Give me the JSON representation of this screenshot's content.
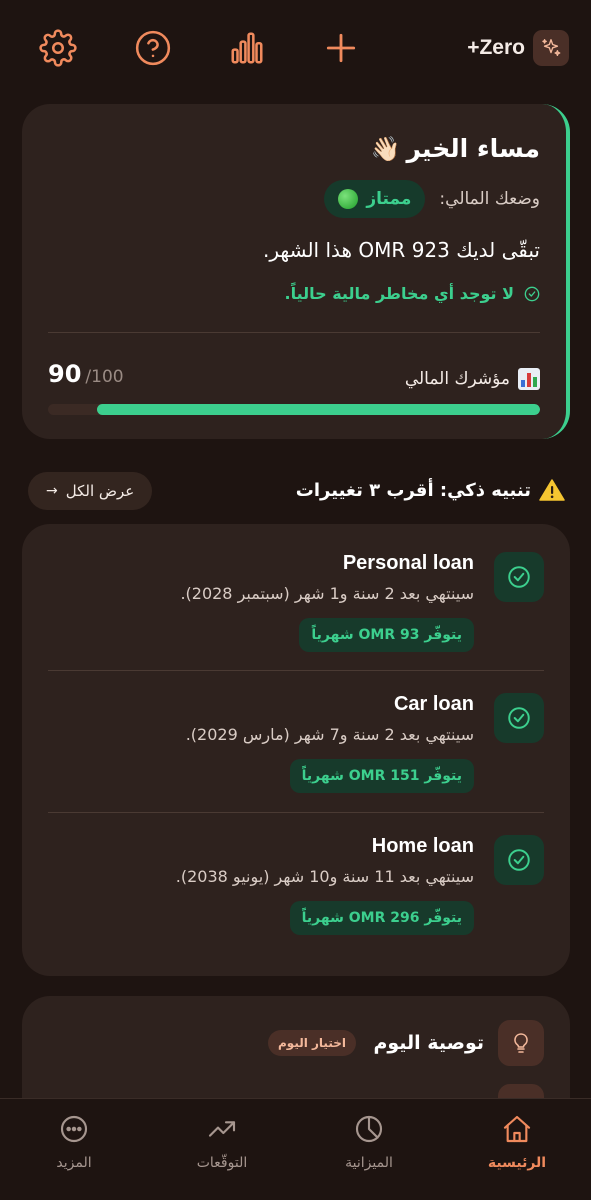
{
  "topbar": {
    "brand_name": "+Zero",
    "icons": [
      "settings-icon",
      "help-icon",
      "stats-icon",
      "add-icon",
      "sparkle-icon"
    ]
  },
  "hero": {
    "greeting": "مساء الخير",
    "greeting_emoji": "👋🏻",
    "status_label": "وضعك المالي:",
    "status_value": "ممتاز",
    "remaining_text": "تبقّى لديك 923 OMR هذا الشهر.",
    "risk_text": "لا توجد أي مخاطر مالية حالياً.",
    "index_label": "مؤشرك المالي",
    "score": "90",
    "score_max": "/100",
    "score_fraction": 0.9
  },
  "alert": {
    "title": "تنبيه ذكي: أقرب ٣ تغييرات",
    "view_all": "عرض الكل"
  },
  "loans": [
    {
      "title": "Personal loan",
      "desc": "سينتهي بعد 2 سنة و1 شهر (سبتمبر 2028).",
      "saving": "يتوفّر 93 OMR شهرياً"
    },
    {
      "title": "Car loan",
      "desc": "سينتهي بعد 2 سنة و7 شهر (مارس 2029).",
      "saving": "يتوفّر 151 OMR شهرياً"
    },
    {
      "title": "Home loan",
      "desc": "سينتهي بعد 11 سنة و10 شهر (يونيو 2038).",
      "saving": "يتوفّر 296 OMR شهرياً"
    }
  ],
  "recommendation": {
    "title": "توصية اليوم",
    "badge": "اختيار اليوم"
  },
  "nav": [
    {
      "label": "الرئيسية",
      "icon": "home-icon",
      "active": true
    },
    {
      "label": "الميزانية",
      "icon": "pie-chart-icon",
      "active": false
    },
    {
      "label": "التوقّعات",
      "icon": "trend-icon",
      "active": false
    },
    {
      "label": "المزيد",
      "icon": "more-icon",
      "active": false
    }
  ],
  "colors": {
    "background": "#1e1411",
    "card": "#2e221e",
    "accent_orange": "#f08a5d",
    "accent_green": "#3ccf8e"
  }
}
